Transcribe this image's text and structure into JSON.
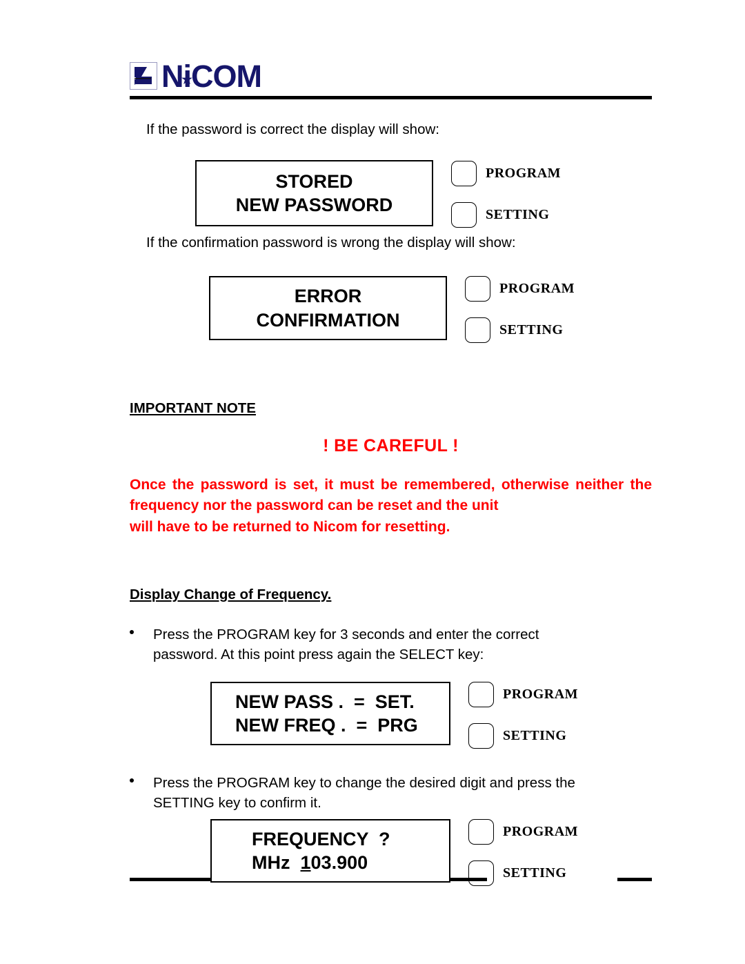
{
  "header": {
    "logo_text": "NiCOM",
    "logo_color": "#16166b",
    "logo_mark_name": "nicom-arrow-mark"
  },
  "intro": {
    "line1": "If the password is correct the display will show:",
    "line2": "If the confirmation password is wrong the display will show:"
  },
  "displays": [
    {
      "name": "stored-new-password-display",
      "line1": "STORED",
      "line2": "NEW PASSWORD",
      "key1": "PROGRAM",
      "key2": "SETTING"
    },
    {
      "name": "error-confirmation-display",
      "line1": "ERROR",
      "line2": "CONFIRMATION",
      "key1": "PROGRAM",
      "key2": "SETTING"
    },
    {
      "name": "new-pass-new-freq-display",
      "line1": "NEW PASS .  =  SET.",
      "line2": "NEW FREQ .  =  PRG",
      "key1": "PROGRAM",
      "key2": "SETTING"
    },
    {
      "name": "frequency-display",
      "line1": "FREQUENCY  ?",
      "line2_prefix": "MHz  ",
      "line2_cursor": "1",
      "line2_rest": "03.900",
      "key1": "PROGRAM",
      "key2": "SETTING"
    }
  ],
  "important_note": {
    "heading": "IMPORTANT NOTE",
    "careful": "! BE CAREFUL !",
    "warning_body": "Once the password is set, it must be remembered, otherwise neither the frequency nor the password can be reset and the unit",
    "warning_last": "will have to be returned to Nicom for resetting.",
    "warning_color": "#ff0000"
  },
  "frequency_section": {
    "heading": "Display Change of Frequency.",
    "bullet1": "Press the PROGRAM key for 3 seconds and enter the correct",
    "bullet1_last": "password. At this point press again the SELECT key:",
    "bullet2": "Press the PROGRAM key to change the desired digit and press the",
    "bullet2_last": "SETTING key to confirm it."
  }
}
